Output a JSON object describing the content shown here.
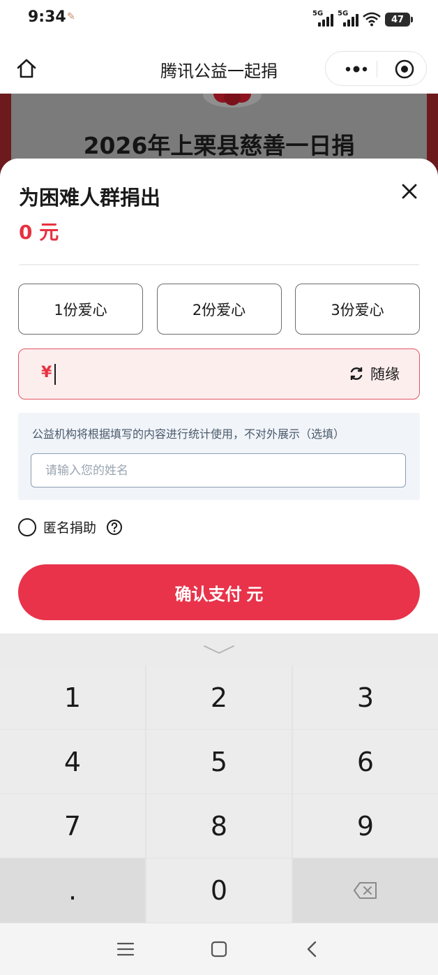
{
  "status_bar": {
    "time": "9:34",
    "network_1": "5G",
    "network_2": "5G",
    "battery": "47"
  },
  "nav_bar": {
    "title": "腾讯公益一起捐",
    "icons": [
      "home-icon",
      "more-icon",
      "close-target-icon"
    ]
  },
  "background_page": {
    "title": "2026年上栗县慈善一日捐"
  },
  "sheet": {
    "title": "为困难人群捐出",
    "amount": "0 元",
    "options": [
      "1份爱心",
      "2份爱心",
      "3份爱心"
    ],
    "currency_symbol": "¥",
    "random_label": "随缘",
    "info_text": "公益机构将根据填写的内容进行统计使用，不对外展示（选填）",
    "name_placeholder": "请输入您的姓名",
    "anonymous_label": "匿名捐助",
    "pay_button": "确认支付 元"
  },
  "keypad": {
    "keys": [
      "1",
      "2",
      "3",
      "4",
      "5",
      "6",
      "7",
      "8",
      "9",
      ".",
      "0",
      "backspace"
    ]
  },
  "colors": {
    "accent": "#e8334a",
    "amount_red": "#e63240",
    "input_bg": "#fdeeee",
    "info_bg": "#f1f4f9"
  }
}
